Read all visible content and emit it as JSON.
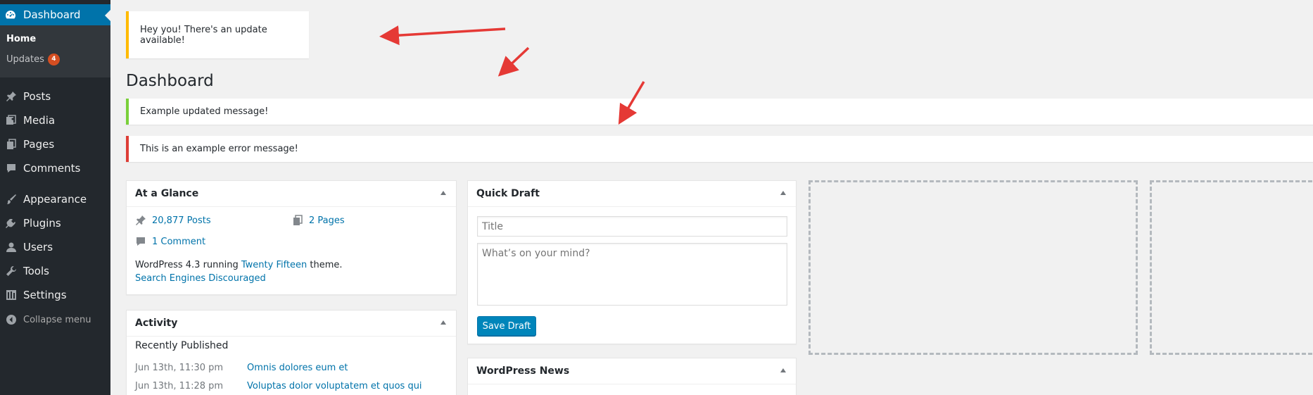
{
  "sidebar": {
    "dashboard": "Dashboard",
    "home": "Home",
    "updates": "Updates",
    "updates_count": "4",
    "items": [
      {
        "label": "Posts",
        "icon": "pushpin-icon"
      },
      {
        "label": "Media",
        "icon": "media-icon"
      },
      {
        "label": "Pages",
        "icon": "pages-icon"
      },
      {
        "label": "Comments",
        "icon": "comments-icon"
      },
      {
        "label": "Appearance",
        "icon": "paintbrush-icon"
      },
      {
        "label": "Plugins",
        "icon": "plugin-icon"
      },
      {
        "label": "Users",
        "icon": "users-icon"
      },
      {
        "label": "Tools",
        "icon": "wrench-icon"
      },
      {
        "label": "Settings",
        "icon": "settings-icon"
      }
    ],
    "collapse": "Collapse menu"
  },
  "notices": {
    "nag": "Hey you! There's an update available!",
    "success": "Example updated message!",
    "error": "This is an example error message!"
  },
  "page_title": "Dashboard",
  "at_glance": {
    "title": "At a Glance",
    "posts": "20,877 Posts",
    "pages": "2 Pages",
    "comments": "1 Comment",
    "version_prefix": "WordPress 4.3 running ",
    "theme": "Twenty Fifteen",
    "version_suffix": " theme.",
    "search_engines": "Search Engines Discouraged"
  },
  "activity": {
    "title": "Activity",
    "recently_published": "Recently Published",
    "rows": [
      {
        "date": "Jun 13th, 11:30 pm",
        "title": "Omnis dolores eum et"
      },
      {
        "date": "Jun 13th, 11:28 pm",
        "title": "Voluptas dolor voluptatem et quos qui"
      }
    ]
  },
  "quick_draft": {
    "title": "Quick Draft",
    "title_placeholder": "Title",
    "content_placeholder": "What’s on your mind?",
    "save": "Save Draft"
  },
  "wp_news": {
    "title": "WordPress News"
  },
  "colors": {
    "sidebar_bg": "#23282d",
    "active": "#0073aa",
    "nag": "#ffba00",
    "success": "#7ad03a",
    "error": "#dd3d36",
    "annotation_arrow": "#e53935"
  }
}
